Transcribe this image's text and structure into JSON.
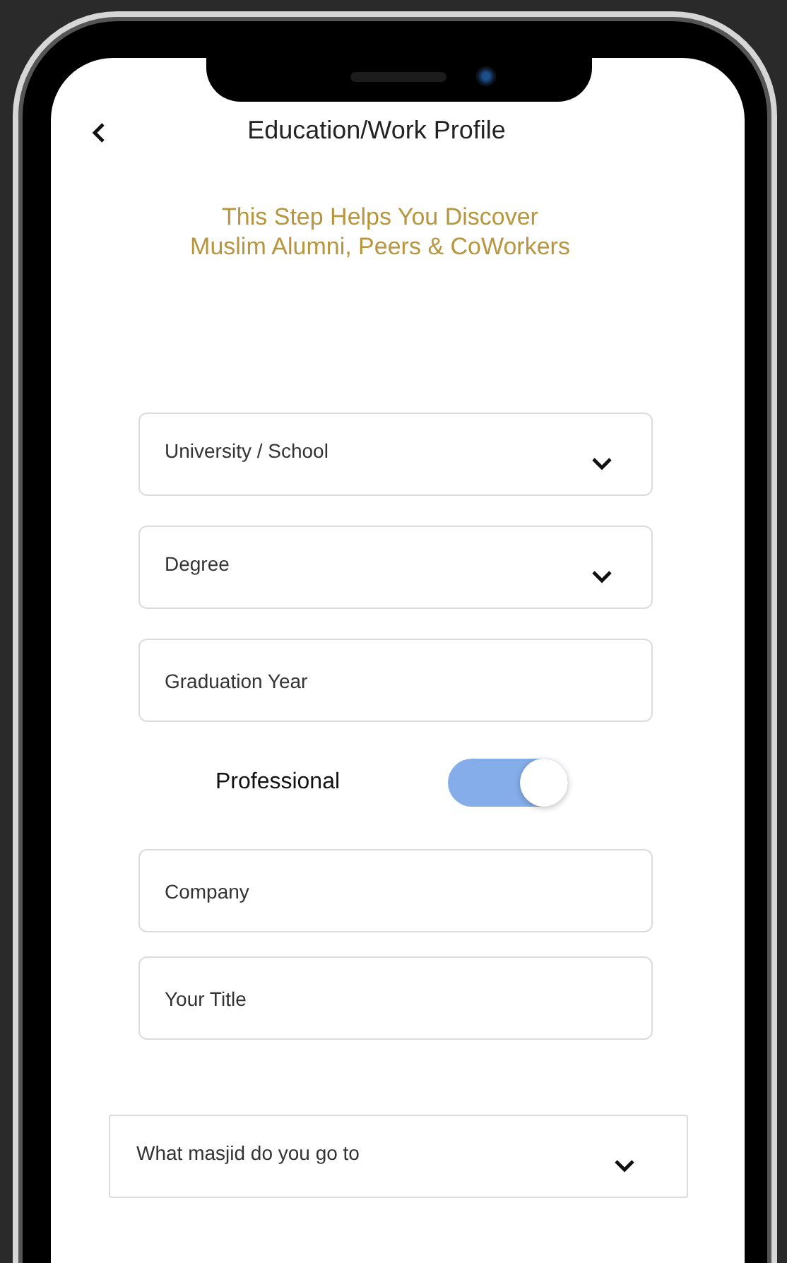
{
  "header": {
    "title": "Education/Work Profile"
  },
  "intro": {
    "lines": [
      "This Step Helps You Discover",
      "Muslim Alumni, Peers & CoWorkers"
    ]
  },
  "education_fields": [
    {
      "kind": "dropdown",
      "placeholder": "University / School"
    },
    {
      "kind": "dropdown",
      "placeholder": "Degree"
    },
    {
      "kind": "text",
      "placeholder": "Graduation Year"
    }
  ],
  "professional": {
    "label": "Professional",
    "on": true
  },
  "work_fields": [
    {
      "kind": "text",
      "placeholder": "Company"
    },
    {
      "kind": "text",
      "placeholder": "Your Title"
    }
  ],
  "masjid": {
    "kind": "dropdown",
    "placeholder": "What masjid do you go to"
  }
}
